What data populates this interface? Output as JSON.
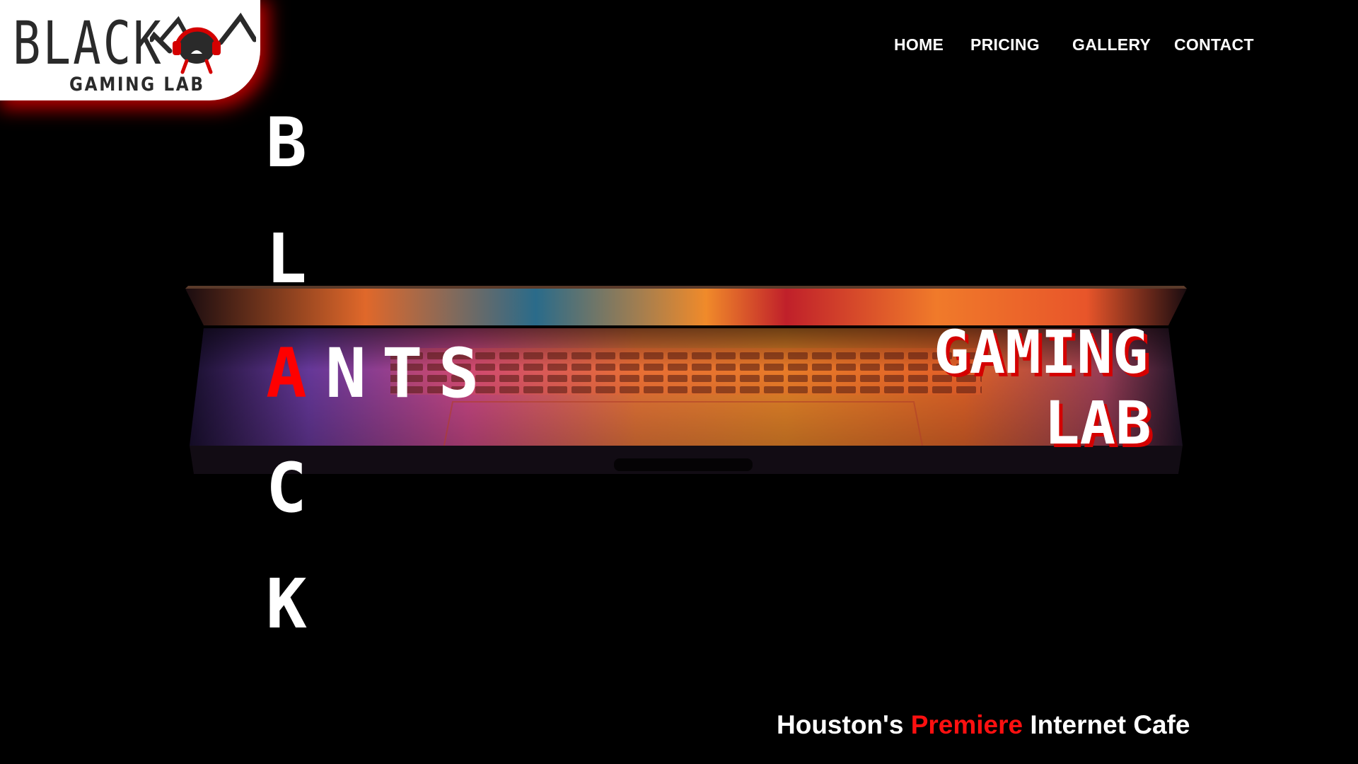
{
  "logo": {
    "word": "BLACK",
    "subtitle": "GAMING LAB",
    "icon": "ant-head-icon"
  },
  "nav": {
    "items": [
      {
        "label": "HOME"
      },
      {
        "label": "PRICING"
      },
      {
        "label": "GALLERY"
      },
      {
        "label": "CONTACT"
      }
    ]
  },
  "hero": {
    "vertical_letters": [
      "B",
      "L",
      "A",
      "C",
      "K"
    ],
    "ants_suffix": "NTS",
    "gaming": "GAMING",
    "lab": "LAB",
    "image": "laptop-illustration",
    "tagline": {
      "prefix": "Houston's",
      "accent": "Premiere",
      "suffix": "Internet Cafe"
    }
  },
  "colors": {
    "background": "#000000",
    "accent_red": "#ff0000",
    "text": "#ffffff"
  }
}
